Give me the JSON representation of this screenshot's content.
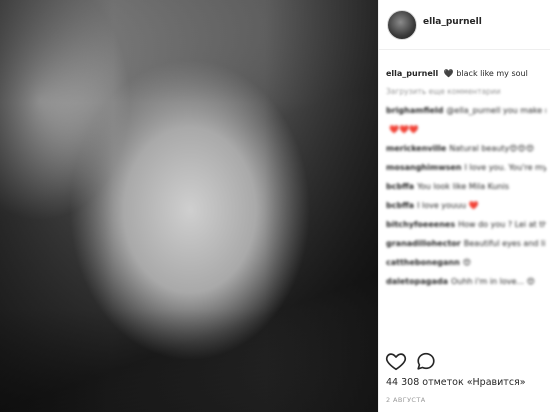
{
  "post": {
    "username": "ella_purnell",
    "photo_alt": "black and white portrait photo",
    "caption": {
      "user": "ella_purnell",
      "heart": "🖤",
      "text": "black like my soul"
    },
    "load_more": "Загрузить еще комментарии",
    "comments": [
      {
        "user": "brighamfield",
        "text": "@ella_purnell you make me smile and there's nothing better tha"
      },
      {
        "user": "",
        "text": "❤️❤️❤️"
      },
      {
        "user": "merickenville",
        "text": "Natural beauty😍😍😍"
      },
      {
        "user": "mosanghimwsen",
        "text": "I love you. You're my favorite actress"
      },
      {
        "user": "bcbffa",
        "text": "You look like Mila Kunis"
      },
      {
        "user": "bcbffa",
        "text": "I love youuu ❤️"
      },
      {
        "user": "bitchyfoeeenes",
        "text": "How do you ? Lei at this angle ?"
      },
      {
        "user": "granadillohector",
        "text": "Beautiful eyes and lips, you are an excellent actress"
      },
      {
        "user": "catthebonegann",
        "text": "😍"
      },
      {
        "user": "daletopagada",
        "text": "Ouhh i'm in love... 😍"
      }
    ],
    "likes_text": "44 308 отметок «Нравится»",
    "date": "2 АВГУСТА",
    "colors": {
      "text": "#262626",
      "muted": "#999999",
      "divider": "#efefef",
      "heart": "#ed4956"
    }
  }
}
